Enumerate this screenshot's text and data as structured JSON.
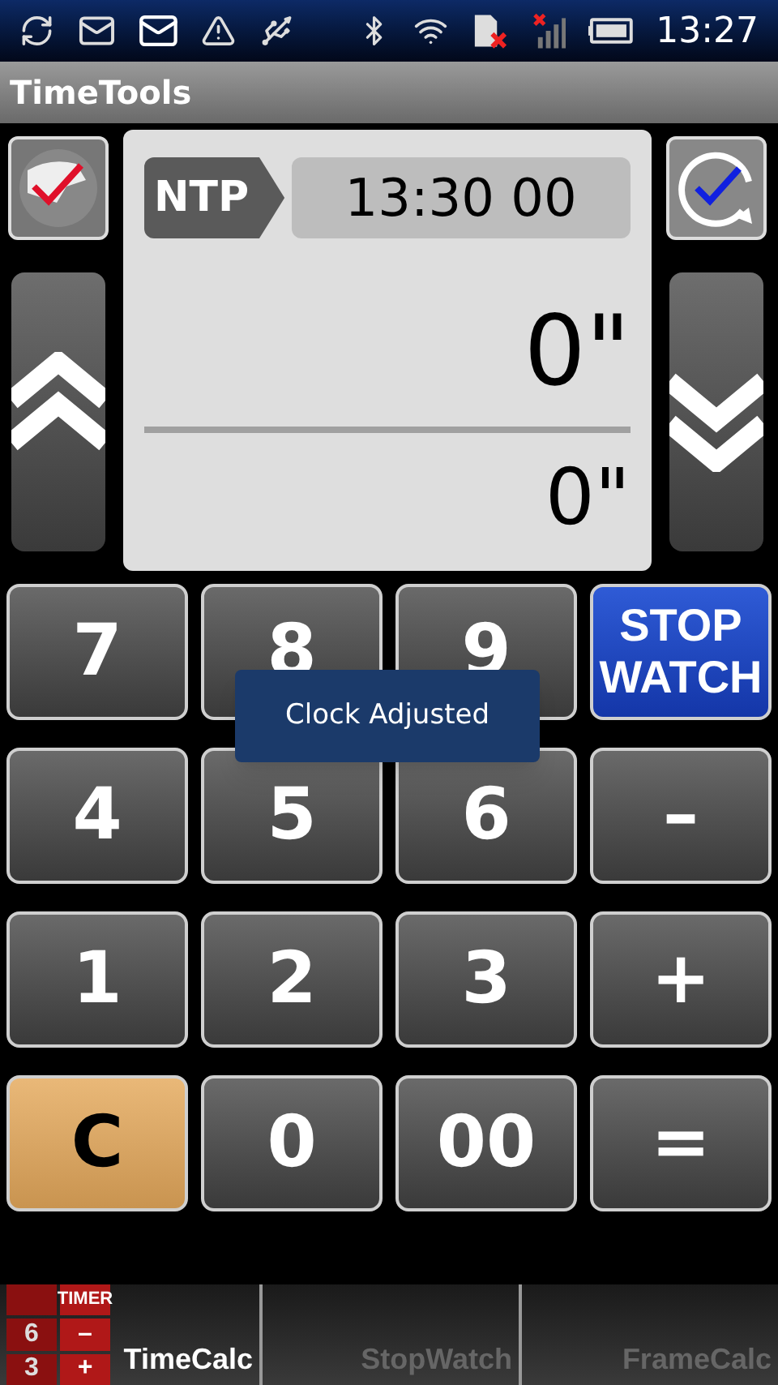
{
  "status_bar": {
    "time": "13:27"
  },
  "title_bar": {
    "title": "TimeTools"
  },
  "display": {
    "source": "NTP",
    "reference_time": "13:30 00",
    "offset": "0\"",
    "total": "0\""
  },
  "keys": [
    {
      "label": "7",
      "kind": "digit"
    },
    {
      "label": "8",
      "kind": "digit"
    },
    {
      "label": "9",
      "kind": "digit"
    },
    {
      "label": "STOP WATCH",
      "kind": "mode"
    },
    {
      "label": "4",
      "kind": "digit"
    },
    {
      "label": "5",
      "kind": "digit"
    },
    {
      "label": "6",
      "kind": "digit"
    },
    {
      "label": "–",
      "kind": "operator"
    },
    {
      "label": "1",
      "kind": "digit"
    },
    {
      "label": "2",
      "kind": "digit"
    },
    {
      "label": "3",
      "kind": "digit"
    },
    {
      "label": "+",
      "kind": "operator"
    },
    {
      "label": "C",
      "kind": "clear"
    },
    {
      "label": "0",
      "kind": "digit"
    },
    {
      "label": "00",
      "kind": "digit"
    },
    {
      "label": "=",
      "kind": "operator"
    }
  ],
  "toast": {
    "message": "Clock Adjusted"
  },
  "tab_icon_labels": [
    "TIMER",
    "6",
    "–",
    "3",
    "+"
  ],
  "tabs": [
    {
      "label": "TimeCalc",
      "selected": true
    },
    {
      "label": "StopWatch",
      "selected": false
    },
    {
      "label": "FrameCalc",
      "selected": false
    }
  ]
}
